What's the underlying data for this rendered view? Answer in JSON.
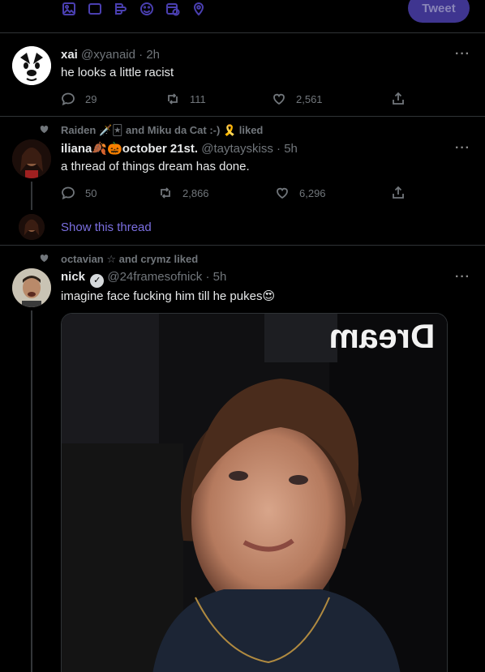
{
  "composer": {
    "icons": [
      "image-icon",
      "gif-icon",
      "poll-icon",
      "emoji-icon",
      "schedule-icon",
      "location-icon"
    ],
    "gif_label": "GIF",
    "tweet_button": "Tweet",
    "accent_color": "#3f3590"
  },
  "tweets": [
    {
      "name": "xai",
      "handle": "@xyanaid",
      "time": "2h",
      "text": "he looks a little racist",
      "replies": "29",
      "retweets": "111",
      "likes": "2,561"
    },
    {
      "liked_by": "Raiden 🗡️🃏 and Miku da Cat :-) 🎗️ liked",
      "name": "iliana🍂🎃october 21st.",
      "handle": "@taytayskiss",
      "time": "5h",
      "text": "a thread of things dream has done.",
      "replies": "50",
      "retweets": "2,866",
      "likes": "6,296",
      "show_thread": "Show this thread"
    },
    {
      "liked_by": "octavian ☆ and crymz liked",
      "name": "nick",
      "handle": "@24framesofnick",
      "time": "5h",
      "text": "imagine face fucking him till he pukes😍",
      "media_sign": "Dream"
    }
  ],
  "dot": "·",
  "more": "···",
  "link_color": "#7b6fe0"
}
